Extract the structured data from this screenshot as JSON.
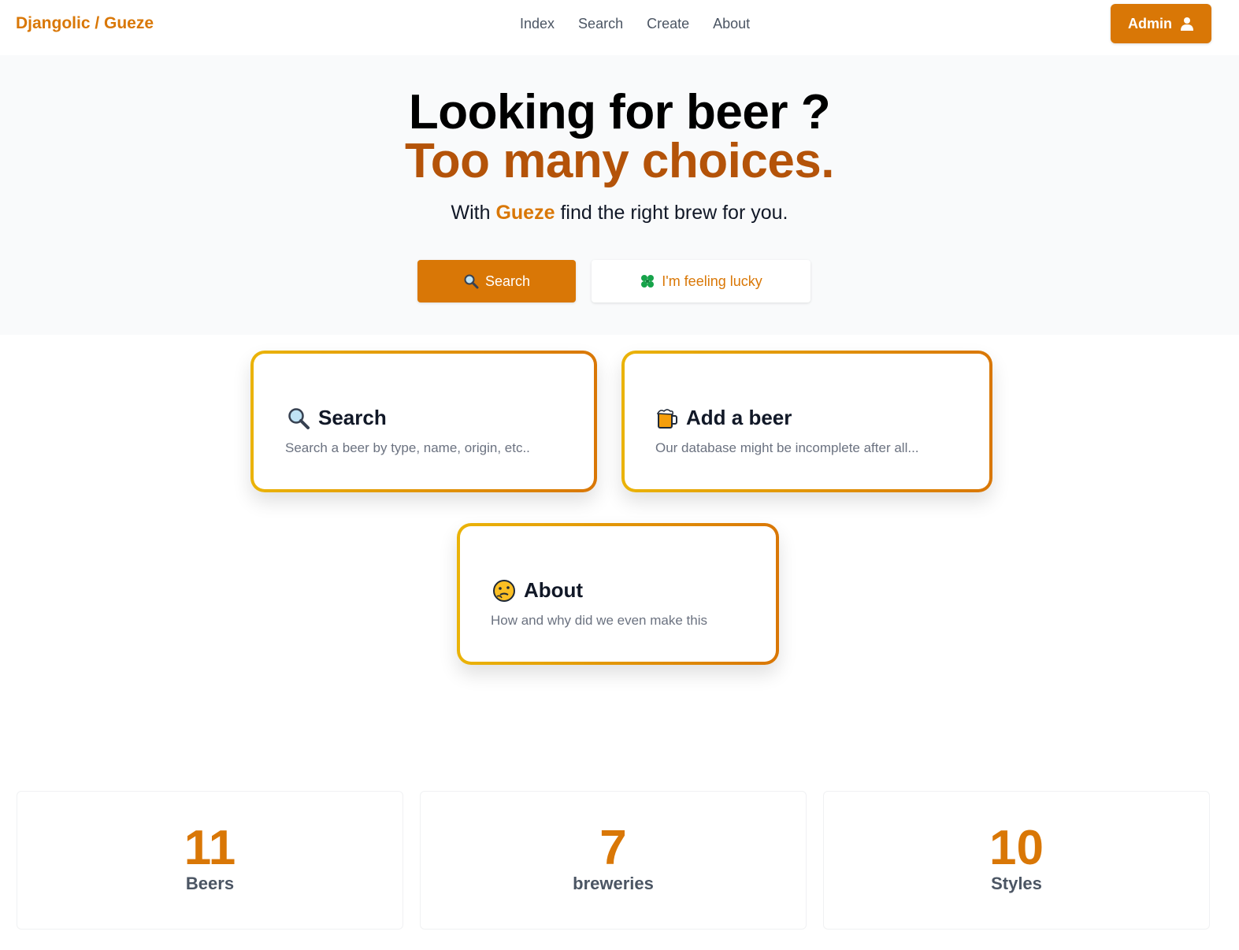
{
  "nav": {
    "brand": "Djangolic / Gueze",
    "links": [
      "Index",
      "Search",
      "Create",
      "About"
    ],
    "admin_label": "Admin",
    "admin_icon": "user-icon"
  },
  "hero": {
    "title_line1": "Looking for beer ?",
    "title_line2": "Too many choices.",
    "subtitle_prefix": "With",
    "subtitle_brand": "Gueze",
    "subtitle_suffix": "find the right brew for you.",
    "search_button": "Search",
    "search_button_icon": "magnifier-icon",
    "lucky_button": "I'm feeling lucky",
    "lucky_button_icon": "clover-icon"
  },
  "cards": [
    {
      "title": "Search",
      "description": "Search a beer by type, name, origin, etc..",
      "icon": "magnifier-icon"
    },
    {
      "title": "Add a beer",
      "description": "Our database might be incomplete after all...",
      "icon": "beer-mug-icon"
    },
    {
      "title": "About",
      "description": "How and why did we even make this",
      "icon": "thinking-face-icon"
    }
  ],
  "stats": [
    {
      "value": "11",
      "label": "Beers"
    },
    {
      "value": "7",
      "label": "breweries"
    },
    {
      "value": "10",
      "label": "Styles"
    }
  ],
  "colors": {
    "accent": "#d97706",
    "accent_dark": "#b45309",
    "card_gradient_start": "#eab308",
    "hero_background": "#f9fafb"
  }
}
